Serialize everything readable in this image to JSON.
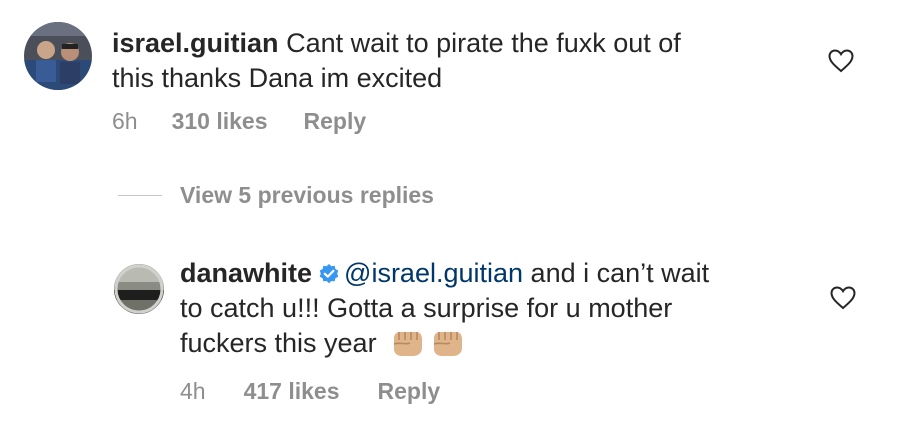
{
  "comment": {
    "username": "israel.guitian",
    "text": "Cant wait to pirate the fuxk out of this thanks Dana im excited",
    "line1": "Cant wait to pirate the fuxk out of",
    "line2": "this thanks Dana im excited",
    "time": "6h",
    "likes": "310 likes",
    "reply": "Reply"
  },
  "thread": {
    "view_replies": "View 5 previous replies"
  },
  "reply_comment": {
    "username": "danawhite",
    "mention": "@israel.guitian",
    "line1_after": "and i can’t wait",
    "line2": "to catch u!!! Gotta a surprise for u mother",
    "line3": "fuckers this year",
    "emoji": [
      "fisted-hand-light-skin-tone",
      "fisted-hand-light-skin-tone"
    ],
    "time": "4h",
    "likes": "417 likes",
    "reply": "Reply"
  },
  "colors": {
    "text": "#262626",
    "meta": "#8e8e8e",
    "mention": "#00376b",
    "verified": "#3897f0"
  }
}
